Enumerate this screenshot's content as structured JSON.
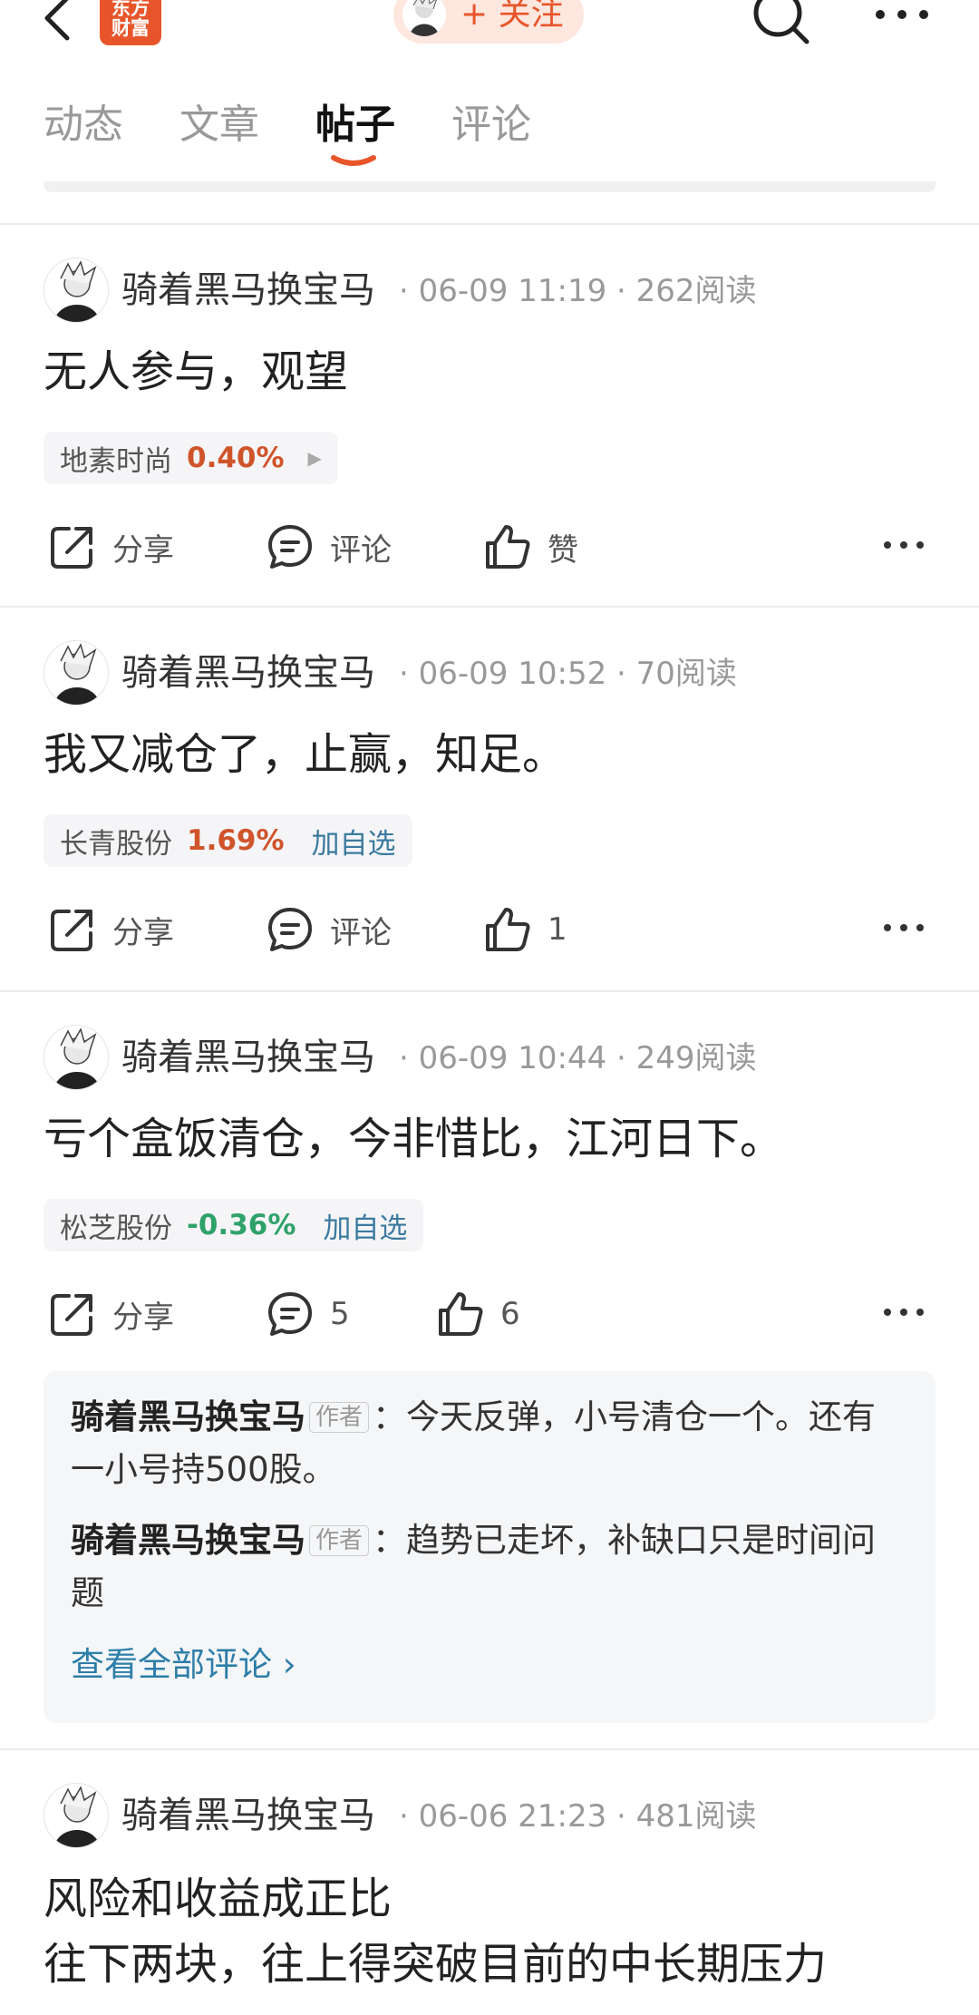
{
  "header": {
    "logo_line1": "东方",
    "logo_line2": "财富",
    "follow_label": "+ 关注"
  },
  "tabs": [
    {
      "label": "动态"
    },
    {
      "label": "文章"
    },
    {
      "label": "帖子"
    },
    {
      "label": "评论"
    }
  ],
  "posts": [
    {
      "author": "骑着黑马换宝马",
      "meta": "· 06-09 11:19 · 262阅读",
      "lines": [
        "无人参与，观望"
      ],
      "stock": {
        "name": "地素时尚",
        "pct": "0.40%",
        "add": ""
      },
      "actions": {
        "share": "分享",
        "comment": "评论",
        "like": "赞"
      }
    },
    {
      "author": "骑着黑马换宝马",
      "meta": "· 06-09 10:52 · 70阅读",
      "lines": [
        "我又减仓了，止赢，知足。"
      ],
      "stock": {
        "name": "长青股份",
        "pct": "1.69%",
        "add": "加自选"
      },
      "actions": {
        "share": "分享",
        "comment": "评论",
        "like": "1"
      }
    },
    {
      "author": "骑着黑马换宝马",
      "meta": "· 06-09 10:44 · 249阅读",
      "lines": [
        "亏个盒饭清仓，今非惜比，江河日下。"
      ],
      "stock": {
        "name": "松芝股份",
        "pct": "-0.36%",
        "add": "加自选"
      },
      "actions": {
        "share": "分享",
        "comment": "5",
        "like": "6"
      },
      "comments": [
        {
          "author": "骑着黑马换宝马",
          "badge": "作者",
          "sep": "：",
          "text": "今天反弹，小号清仓一个。还有一小号持500股。"
        },
        {
          "author": "骑着黑马换宝马",
          "badge": "作者",
          "sep": "：",
          "text": "趋势已走坏，补缺口只是时间问题"
        }
      ],
      "view_all": "查看全部评论 ›"
    },
    {
      "author": "骑着黑马换宝马",
      "meta": "· 06-06 21:23 · 481阅读",
      "lines": [
        "风险和收益成正比",
        "往下两块，往上得突破目前的中长期压力"
      ]
    }
  ],
  "colors": {
    "accent": "#e8552a",
    "up": "#d0542a",
    "down": "#2ea26a",
    "link": "#2d7ea8"
  }
}
